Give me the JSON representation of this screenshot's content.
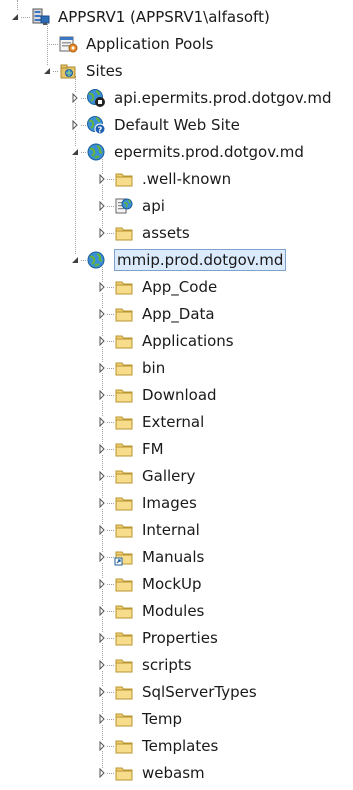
{
  "tree": {
    "server": {
      "label": "APPSRV1 (APPSRV1\\alfasoft)",
      "icon": "server-icon"
    },
    "app_pools": {
      "label": "Application Pools",
      "icon": "app-pool-icon"
    },
    "sites": {
      "label": "Sites",
      "icon": "sites-folder-icon"
    },
    "site1": {
      "label": "api.epermits.prod.dotgov.md",
      "icon": "stopped-site-globe-icon"
    },
    "site2": {
      "label": "Default Web Site",
      "icon": "unknown-site-globe-icon"
    },
    "site3": {
      "label": "epermits.prod.dotgov.md",
      "icon": "site-globe-icon",
      "children": [
        {
          "label": ".well-known",
          "icon": "folder-icon"
        },
        {
          "label": "api",
          "icon": "web-application-icon"
        },
        {
          "label": "assets",
          "icon": "folder-icon"
        }
      ]
    },
    "site4": {
      "label": "mmip.prod.dotgov.md",
      "icon": "site-globe-icon",
      "children": [
        {
          "label": "App_Code",
          "icon": "folder-icon"
        },
        {
          "label": "App_Data",
          "icon": "folder-icon"
        },
        {
          "label": "Applications",
          "icon": "folder-icon"
        },
        {
          "label": "bin",
          "icon": "folder-icon"
        },
        {
          "label": "Download",
          "icon": "folder-icon"
        },
        {
          "label": "External",
          "icon": "folder-icon"
        },
        {
          "label": "FM",
          "icon": "folder-icon"
        },
        {
          "label": "Gallery",
          "icon": "folder-icon"
        },
        {
          "label": "Images",
          "icon": "folder-icon"
        },
        {
          "label": "Internal",
          "icon": "folder-icon"
        },
        {
          "label": "Manuals",
          "icon": "virtual-directory-icon"
        },
        {
          "label": "MockUp",
          "icon": "folder-icon"
        },
        {
          "label": "Modules",
          "icon": "folder-icon"
        },
        {
          "label": "Properties",
          "icon": "folder-icon"
        },
        {
          "label": "scripts",
          "icon": "folder-icon"
        },
        {
          "label": "SqlServerTypes",
          "icon": "folder-icon"
        },
        {
          "label": "Temp",
          "icon": "folder-icon"
        },
        {
          "label": "Templates",
          "icon": "folder-icon"
        },
        {
          "label": "webasm",
          "icon": "folder-icon"
        }
      ]
    }
  }
}
